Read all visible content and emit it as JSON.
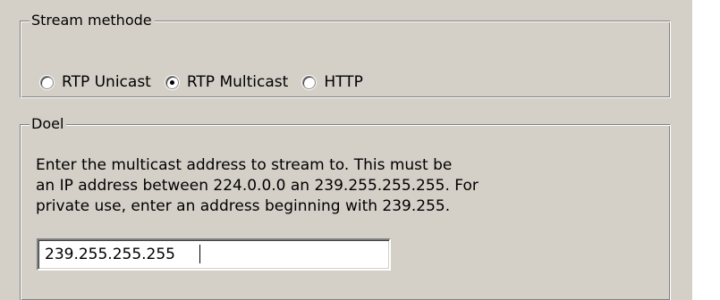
{
  "stream_method": {
    "legend": "Stream methode",
    "options": [
      {
        "label": "RTP Unicast",
        "checked": false
      },
      {
        "label": "RTP Multicast",
        "checked": true
      },
      {
        "label": "HTTP",
        "checked": false
      }
    ]
  },
  "target": {
    "legend": "Doel",
    "description_lines": [
      "Enter the multicast address to stream to. This must be",
      "an IP address between 224.0.0.0 an 239.255.255.255. For",
      "private use, enter an address beginning with 239.255."
    ],
    "address_value": "239.255.255.255"
  }
}
